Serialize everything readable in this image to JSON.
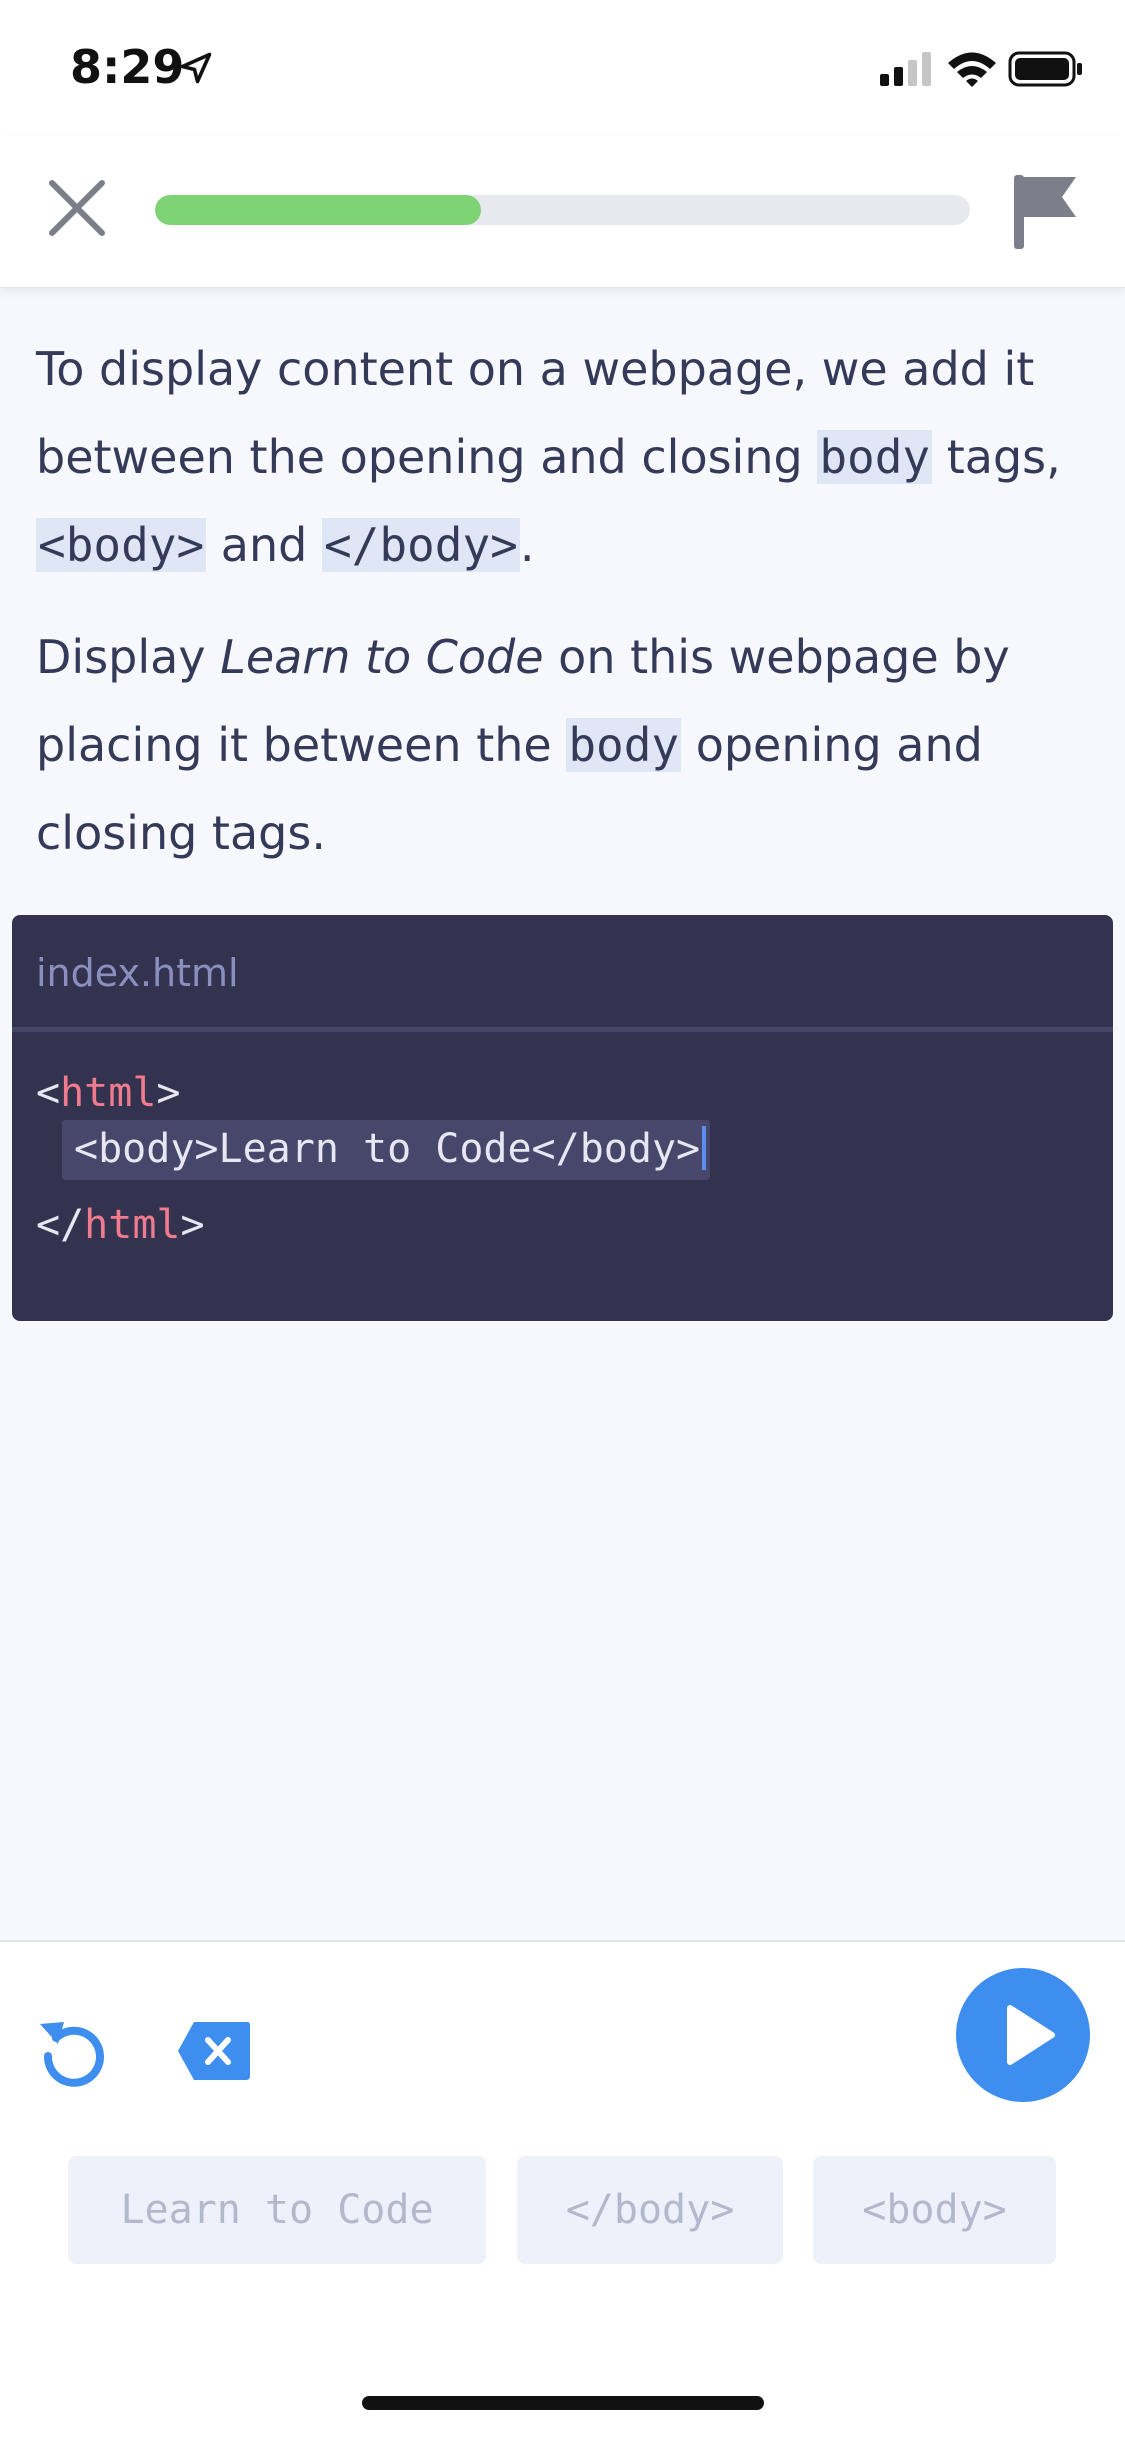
{
  "status_bar": {
    "time": "8:29"
  },
  "top_nav": {
    "progress": 0.4
  },
  "instructions": {
    "p1_part1": "To display content on a webpage, we add it between the opening and closing ",
    "p1_code1": "body",
    "p1_part2": " tags, ",
    "p1_code2": "<body>",
    "p1_part3": " and ",
    "p1_code3": "</body>",
    "p1_part4": ".",
    "p2_part1": "Display ",
    "p2_em": "Learn to Code",
    "p2_part2": " on this webpage by placing it between the ",
    "p2_code1": "body",
    "p2_part3": " opening and closing tags."
  },
  "editor": {
    "file_name": "index.html",
    "line1_open": "<",
    "line1_tag": "html",
    "line1_close": ">",
    "line2_text": "<body>Learn to Code</body>",
    "line3_open": "</",
    "line3_tag": "html",
    "line3_close": ">"
  },
  "tokens": [
    {
      "label": "Learn to Code"
    },
    {
      "label": "</body>"
    },
    {
      "label": "<body>"
    }
  ],
  "colors": {
    "accent": "#3e8ef0",
    "progress": "#7ed474",
    "editor_bg": "#33334f",
    "tag": "#f07b8f"
  },
  "icons": {
    "close": "close-icon",
    "flag": "flag-icon",
    "reset": "reset-icon",
    "backspace": "backspace-icon",
    "run": "play-icon"
  }
}
